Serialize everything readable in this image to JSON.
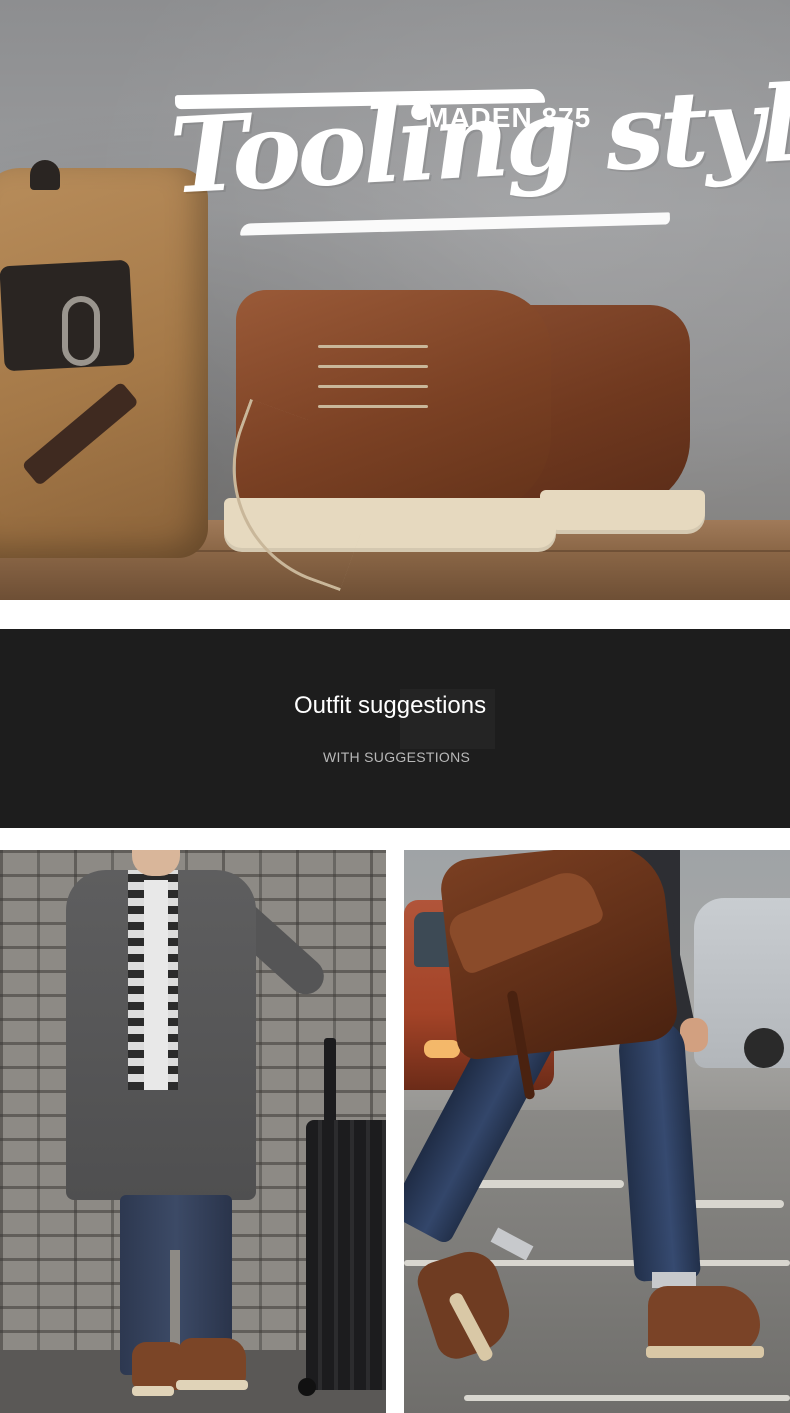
{
  "hero": {
    "script_title": "Tooling style",
    "brand_tag": "MADEN 875"
  },
  "section": {
    "heading": "Outfit suggestions",
    "subheading": "WITH SUGGESTIONS"
  },
  "colors": {
    "banner_background": "#1d1d1d",
    "page_background": "#ffffff",
    "boot_leather": "#7b4124",
    "sole_cream": "#e6d9bf"
  }
}
